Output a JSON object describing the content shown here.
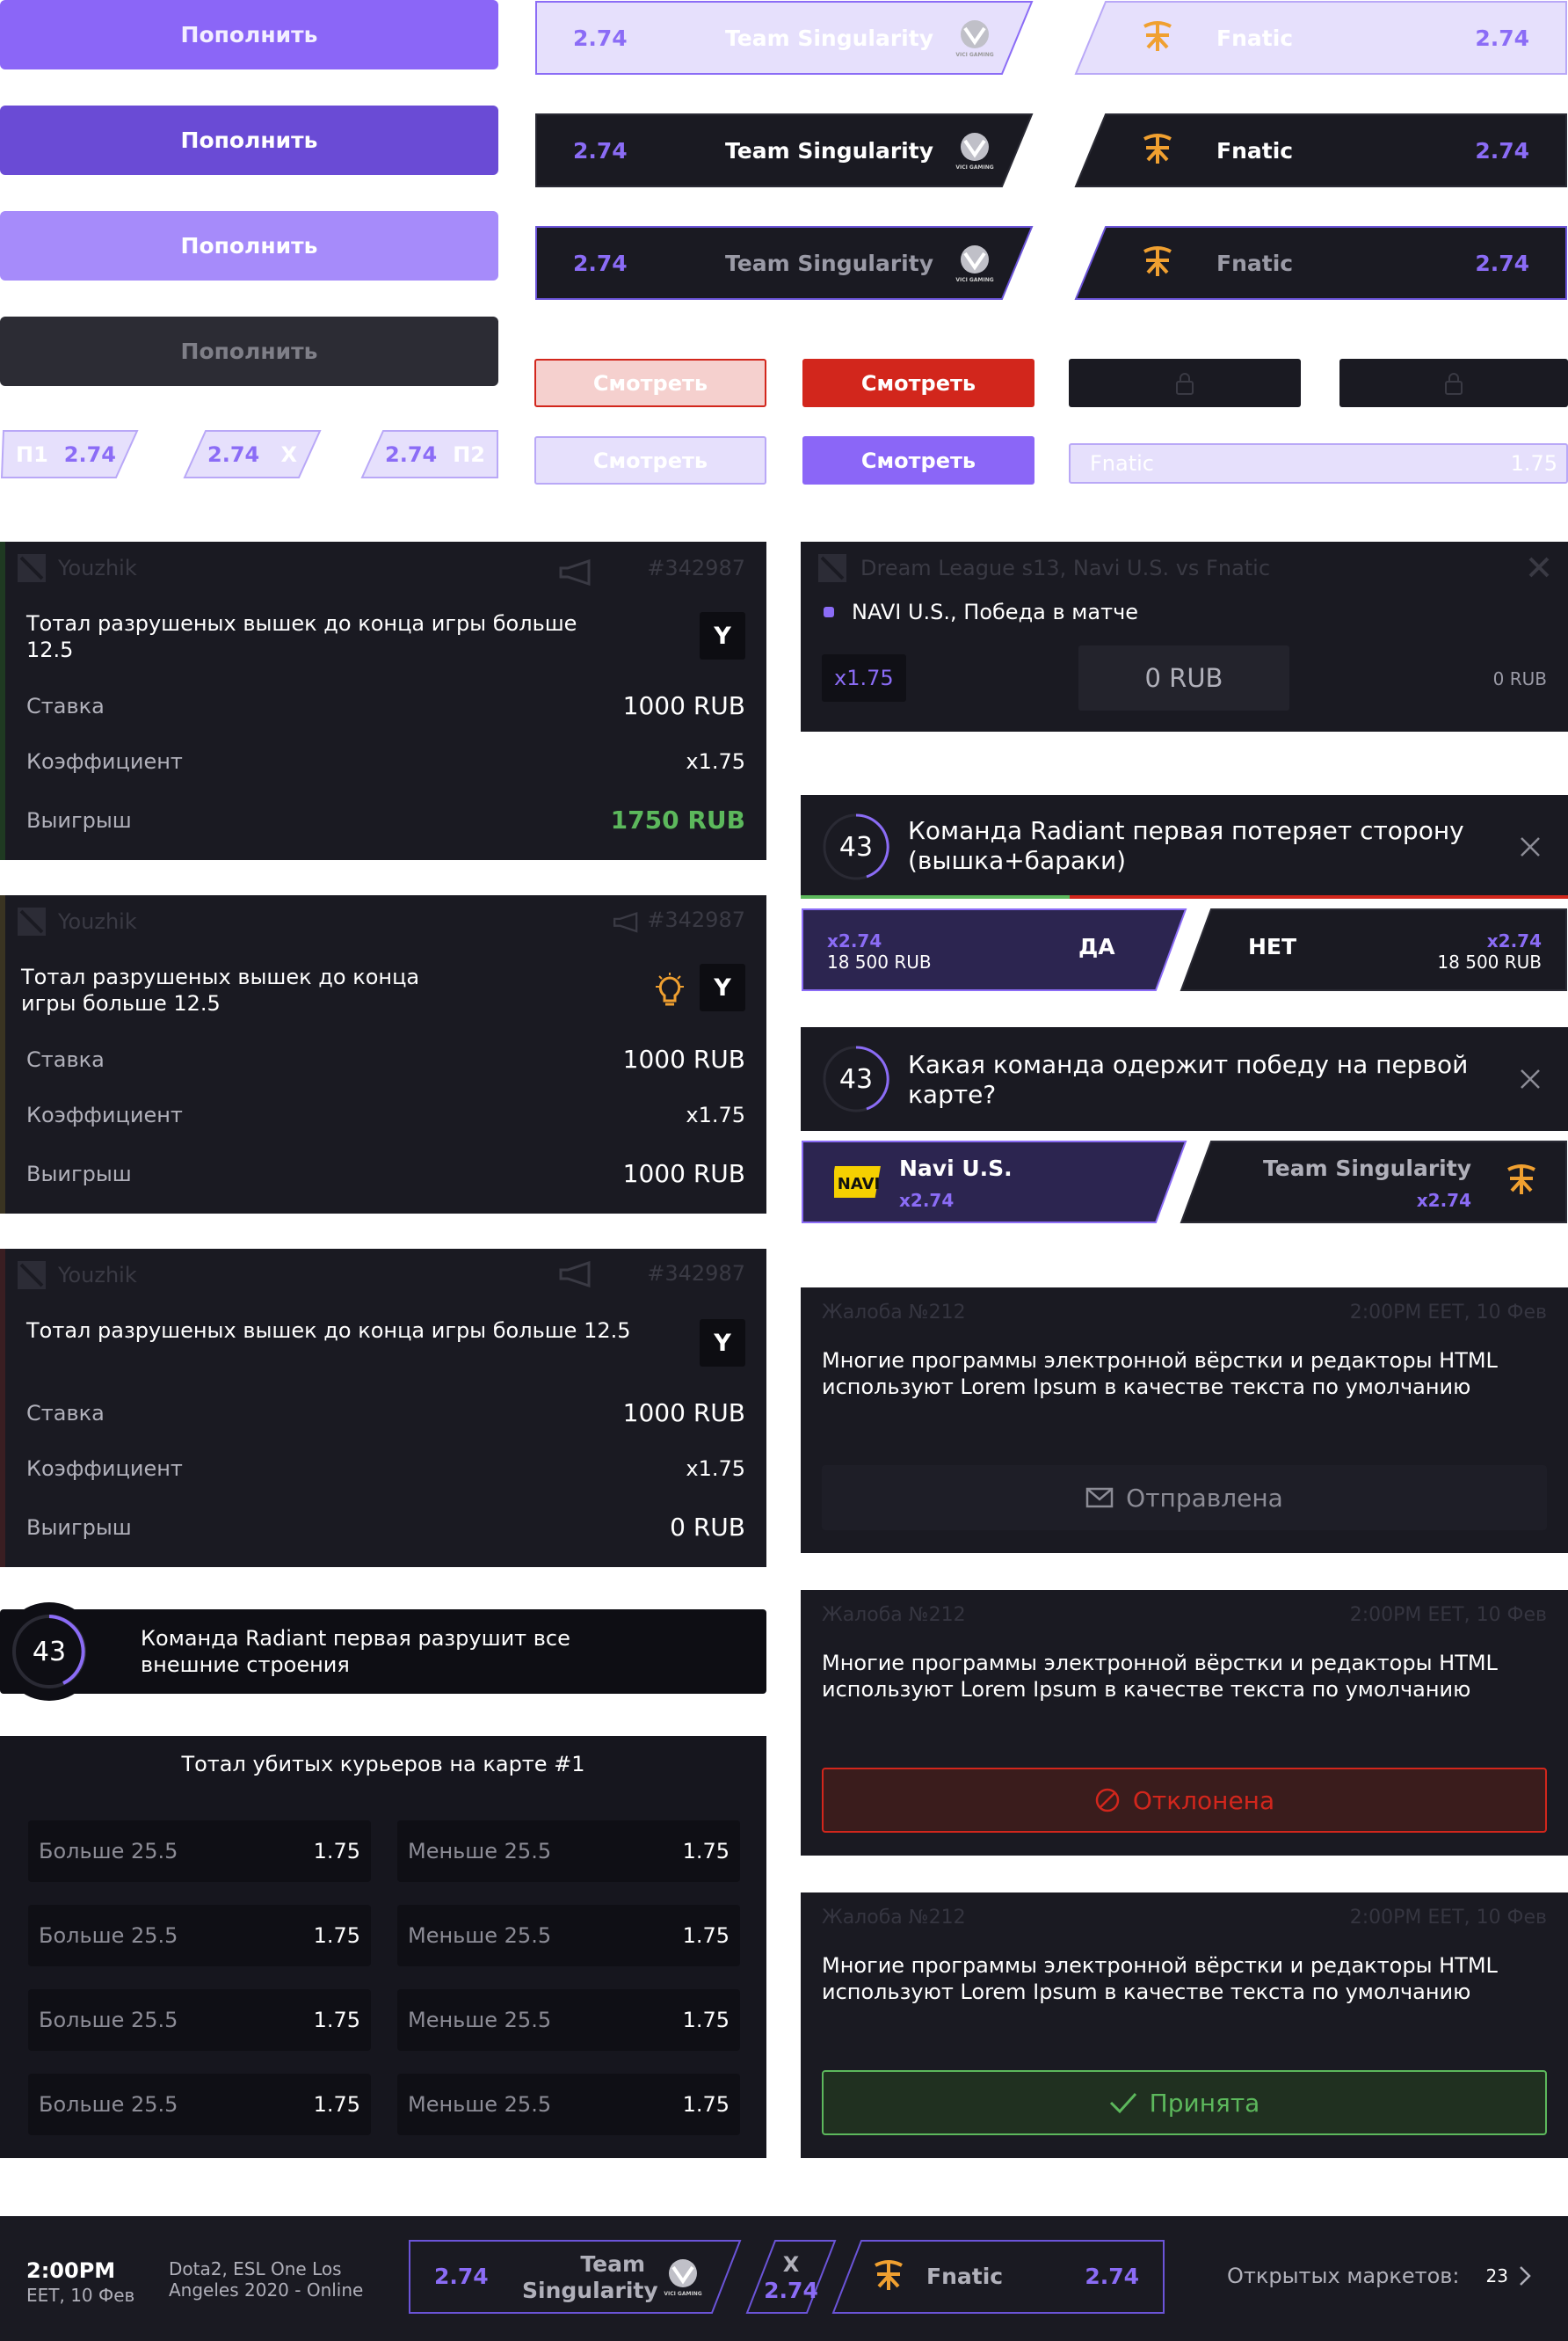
{
  "colors": {
    "accent": "#8b6cf6",
    "dark": "#1a1a22",
    "red": "#d2261c",
    "green": "#5cb85c",
    "orange": "#f0a030"
  },
  "topup": {
    "label": "Пополнить"
  },
  "team_a": {
    "name": "Team Singularity",
    "odds": "2.74",
    "logo": "vici-gaming-logo",
    "logo_text": "VICI GAMING"
  },
  "team_b": {
    "name": "Fnatic",
    "odds": "2.74",
    "logo": "fnatic-logo",
    "logo_text": "FNATIC"
  },
  "pills": [
    {
      "left": "П1",
      "right": "2.74"
    },
    {
      "left": "2.74",
      "right": "X"
    },
    {
      "left": "2.74",
      "right": "П2"
    }
  ],
  "watch": {
    "label": "Смотреть"
  },
  "lock_icon": "lock-icon",
  "fnatic_input": {
    "name": "Fnatic",
    "odds": "1.75"
  },
  "bet_cards": [
    {
      "user": "Youzhik",
      "id": "#342987",
      "question": "Тотал разрушеных вышек до конца игры больше 12.5",
      "answer": "Y",
      "stake_label": "Ставка",
      "stake": "1000 RUB",
      "coef_label": "Коэффициент",
      "coef": "x1.75",
      "win_label": "Выигрыш",
      "win": "1750 RUB",
      "status": "won"
    },
    {
      "user": "Youzhik",
      "id": "#342987",
      "question": "Тотал разрушеных вышек до конца игры больше 12.5",
      "answer": "Y",
      "stake_label": "Ставка",
      "stake": "1000 RUB",
      "coef_label": "Коэффициент",
      "coef": "x1.75",
      "win_label": "Выигрыш",
      "win": "1000 RUB",
      "status": "pending"
    },
    {
      "user": "Youzhik",
      "id": "#342987",
      "question": "Тотал разрушеных вышек до конца игры больше 12.5",
      "answer": "Y",
      "stake_label": "Ставка",
      "stake": "1000 RUB",
      "coef_label": "Коэффициент",
      "coef": "x1.75",
      "win_label": "Выигрыш",
      "win": "0 RUB",
      "status": "lost"
    }
  ],
  "timer_bar": {
    "time": "43",
    "text": "Команда Radiant первая разрушит все внешние строения"
  },
  "markets": {
    "title": "Тотал убитых курьеров на карте  #1",
    "rows": [
      {
        "a": "Больше 25.5",
        "ao": "1.75",
        "b": "Меньше 25.5",
        "bo": "1.75"
      },
      {
        "a": "Больше 25.5",
        "ao": "1.75",
        "b": "Меньше 25.5",
        "bo": "1.75"
      },
      {
        "a": "Больше 25.5",
        "ao": "1.75",
        "b": "Меньше 25.5",
        "bo": "1.75"
      },
      {
        "a": "Больше 25.5",
        "ao": "1.75",
        "b": "Меньше 25.5",
        "bo": "1.75"
      }
    ]
  },
  "coupon": {
    "title": "Dream League s13, Navi U.S. vs Fnatic",
    "selection": "NAVI U.S., Победа в матче",
    "odds": "x1.75",
    "amount": "0 RUB",
    "payout": "0 RUB"
  },
  "q1": {
    "time": "43",
    "text": "Команда Radiant первая потеряет сторону (вышка+бараки)",
    "yes": {
      "odds": "x2.74",
      "sum": "18 500 RUB",
      "label": "ДА"
    },
    "no": {
      "odds": "x2.74",
      "sum": "18 500 RUB",
      "label": "НЕТ"
    }
  },
  "q2": {
    "time": "43",
    "text": "Какая команда одержит победу на первой карте?",
    "a": {
      "name": "Navi U.S.",
      "odds": "x2.74",
      "logo_text": "NAVI"
    },
    "b": {
      "name": "Team Singularity",
      "odds": "x2.74"
    }
  },
  "complaints": [
    {
      "title": "Жалоба №212",
      "date": "2:00PM EET, 10 Фев",
      "text": "Многие программы электронной вёрстки и редакторы HTML используют Lorem Ipsum в качестве текста по умолчанию",
      "status": "Отправлена"
    },
    {
      "title": "Жалоба №212",
      "date": "2:00PM EET, 10 Фев",
      "text": "Многие программы электронной вёрстки и редакторы HTML используют Lorem Ipsum в качестве текста по умолчанию",
      "status": "Отклонена"
    },
    {
      "title": "Жалоба №212",
      "date": "2:00PM EET, 10 Фев",
      "text": "Многие программы электронной вёрстки и редакторы HTML используют Lorem Ipsum в качестве текста по умолчанию",
      "status": "Принята"
    }
  ],
  "match_bar": {
    "time": "2:00PM",
    "date": "EET, 10 Фев",
    "event": "Dota2, ESL One Los Angeles 2020 - Online",
    "team_a": "Team Singularity",
    "odds_a": "2.74",
    "draw": "X",
    "odds_x": "2.74",
    "team_b": "Fnatic",
    "odds_b": "2.74",
    "markets_label": "Открытых маркетов:",
    "markets_count": "23"
  }
}
